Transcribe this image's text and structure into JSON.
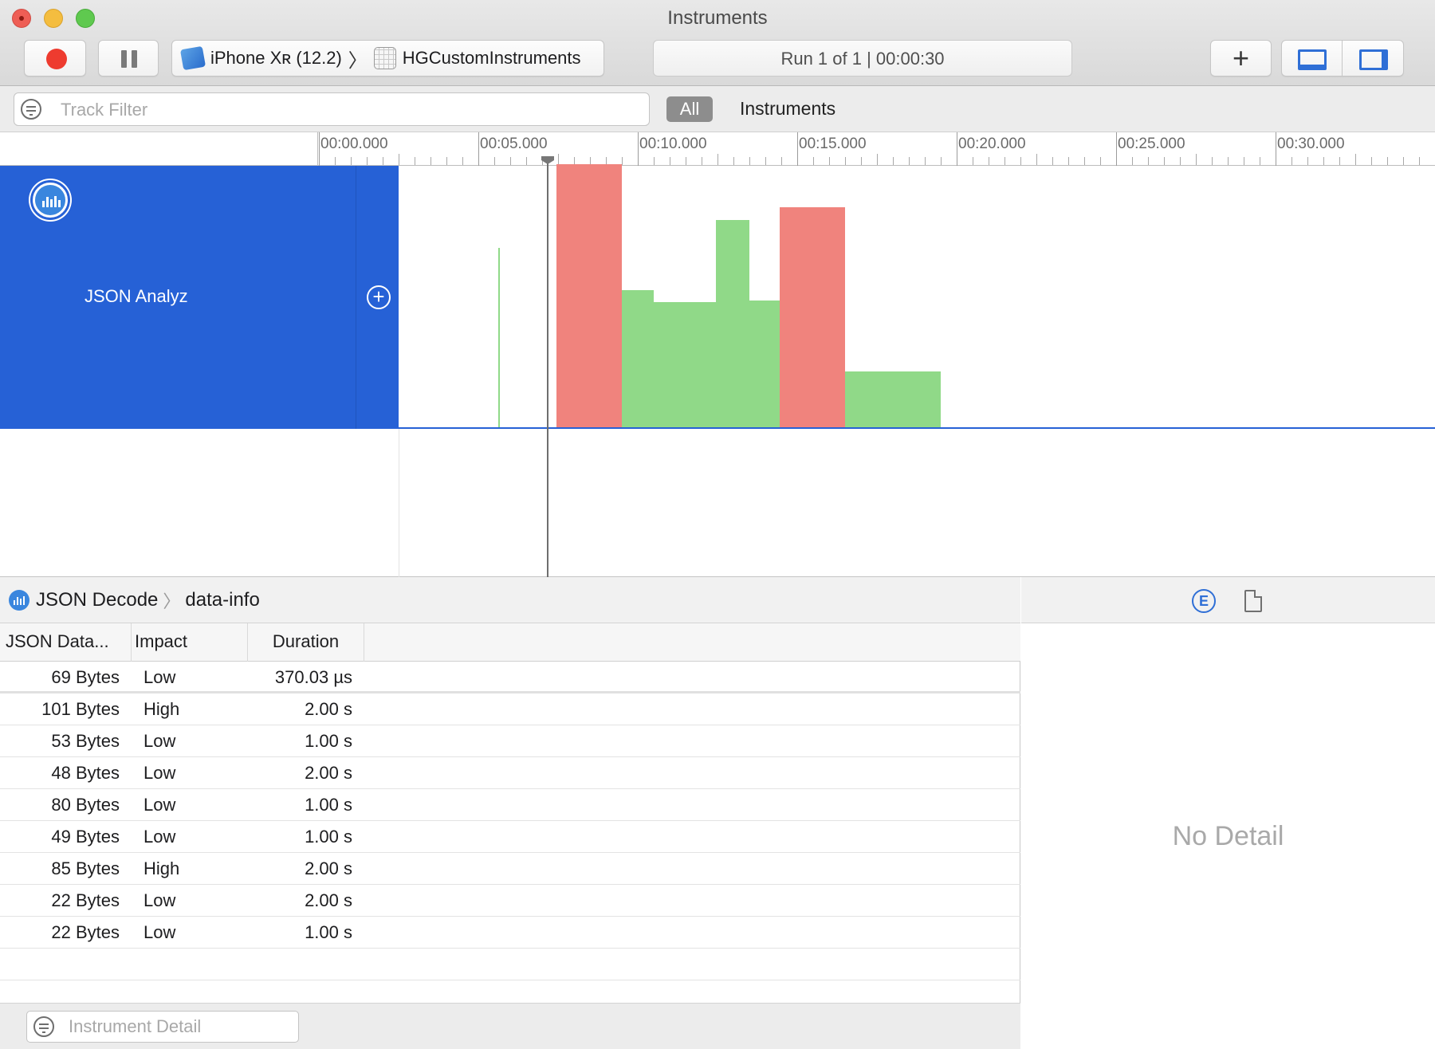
{
  "window": {
    "title": "Instruments"
  },
  "toolbar": {
    "device_label": "iPhone Xʀ (12.2)",
    "target_app": "HGCustomInstruments",
    "run_status": "Run 1 of 1  |  00:00:30"
  },
  "filter": {
    "track_filter_placeholder": "Track Filter",
    "all_label": "All",
    "instruments_label": "Instruments"
  },
  "timeline": {
    "ticks": [
      "00:00.000",
      "00:05.000",
      "00:10.000",
      "00:15.000",
      "00:20.000",
      "00:25.000",
      "00:30.000"
    ],
    "playhead_seconds": 7.2
  },
  "track": {
    "name": "JSON Analyz",
    "colors": {
      "high": "#f0837d",
      "low": "#90d988",
      "header": "#2661d6"
    }
  },
  "breadcrumb": {
    "instrument": "JSON Decode",
    "detail": "data-info"
  },
  "table": {
    "columns": [
      "JSON Data...",
      "Impact",
      "Duration"
    ],
    "rows": [
      {
        "size": "69 Bytes",
        "impact": "Low",
        "duration": "370.03 µs"
      },
      {
        "size": "101 Bytes",
        "impact": "High",
        "duration": "2.00 s"
      },
      {
        "size": "53 Bytes",
        "impact": "Low",
        "duration": "1.00 s"
      },
      {
        "size": "48 Bytes",
        "impact": "Low",
        "duration": "2.00 s"
      },
      {
        "size": "80 Bytes",
        "impact": "Low",
        "duration": "1.00 s"
      },
      {
        "size": "49 Bytes",
        "impact": "Low",
        "duration": "1.00 s"
      },
      {
        "size": "85 Bytes",
        "impact": "High",
        "duration": "2.00 s"
      },
      {
        "size": "22 Bytes",
        "impact": "Low",
        "duration": "2.00 s"
      },
      {
        "size": "22 Bytes",
        "impact": "Low",
        "duration": "1.00 s"
      }
    ]
  },
  "bottom": {
    "instrument_detail_placeholder": "Instrument Detail"
  },
  "inspector": {
    "empty_text": "No Detail"
  }
}
